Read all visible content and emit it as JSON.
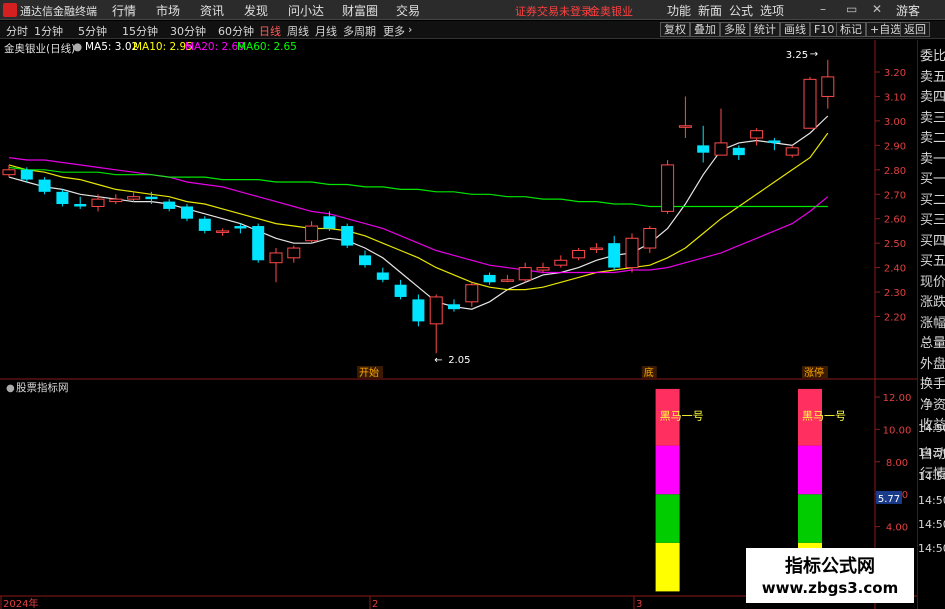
{
  "app": {
    "title": "通达信金融终端",
    "menus": [
      "行情",
      "市场",
      "资讯",
      "发现",
      "问小达",
      "财富圈",
      "交易"
    ],
    "notice": "证券交易未登录",
    "stock_name_header": "金奥银业",
    "right_menus": [
      "功能",
      "新面",
      "公式",
      "选项"
    ],
    "guest": "游客"
  },
  "toolbar": {
    "periods": [
      "分时",
      "1分钟",
      "5分钟",
      "15分钟",
      "30分钟",
      "60分钟",
      "日线",
      "周线",
      "月线",
      "多周期",
      "更多"
    ],
    "active_period": "日线",
    "buttons": [
      "复权",
      "叠加",
      "多股",
      "统计",
      "画线",
      "F10",
      "标记",
      "+自选",
      "返回"
    ]
  },
  "info": {
    "title": "金奥银业(日线)",
    "ma5": "MA5: 3.02",
    "ma10": "MA10: 2.95",
    "ma20": "MA20: 2.69",
    "ma60": "MA60: 2.65"
  },
  "colors": {
    "up": "#ff4a4a",
    "down": "#00e5ff",
    "ma5": "#ffffff",
    "ma10": "#ffff00",
    "ma20": "#ff00ff",
    "ma60": "#00ff00",
    "axis": "#8b1a1a"
  },
  "chart_data": [
    {
      "type": "candlestick",
      "title": "金奥银业(日线)",
      "ylim": [
        2.1,
        3.3
      ],
      "y_ticks": [
        "3.20",
        "3.10",
        "3.00",
        "2.90",
        "2.80",
        "2.70",
        "2.60",
        "2.50",
        "2.40",
        "2.30",
        "2.20"
      ],
      "x_labels": [
        "2024年",
        "2",
        "3"
      ],
      "annotations": [
        {
          "text": "3.25",
          "index": 46
        },
        {
          "text": "2.05",
          "index": 24
        }
      ],
      "markers": [
        {
          "text": "开始",
          "index": 20
        },
        {
          "text": "底",
          "index": 36
        },
        {
          "text": "涨停",
          "index": 45
        }
      ],
      "candles": [
        [
          2.78,
          2.8,
          2.82,
          2.77
        ],
        [
          2.8,
          2.76,
          2.81,
          2.75
        ],
        [
          2.76,
          2.71,
          2.77,
          2.7
        ],
        [
          2.71,
          2.66,
          2.72,
          2.65
        ],
        [
          2.66,
          2.65,
          2.69,
          2.64
        ],
        [
          2.65,
          2.68,
          2.7,
          2.63
        ],
        [
          2.67,
          2.68,
          2.7,
          2.66
        ],
        [
          2.68,
          2.69,
          2.71,
          2.67
        ],
        [
          2.69,
          2.68,
          2.71,
          2.66
        ],
        [
          2.67,
          2.64,
          2.68,
          2.63
        ],
        [
          2.65,
          2.6,
          2.66,
          2.59
        ],
        [
          2.6,
          2.55,
          2.61,
          2.54
        ],
        [
          2.55,
          2.55,
          2.56,
          2.53
        ],
        [
          2.57,
          2.56,
          2.58,
          2.54
        ],
        [
          2.57,
          2.43,
          2.58,
          2.42
        ],
        [
          2.42,
          2.46,
          2.48,
          2.34
        ],
        [
          2.44,
          2.48,
          2.49,
          2.42
        ],
        [
          2.51,
          2.57,
          2.59,
          2.5
        ],
        [
          2.61,
          2.56,
          2.63,
          2.55
        ],
        [
          2.57,
          2.49,
          2.58,
          2.48
        ],
        [
          2.45,
          2.41,
          2.47,
          2.4
        ],
        [
          2.38,
          2.35,
          2.4,
          2.34
        ],
        [
          2.33,
          2.28,
          2.35,
          2.27
        ],
        [
          2.27,
          2.18,
          2.29,
          2.16
        ],
        [
          2.17,
          2.28,
          2.29,
          2.05
        ],
        [
          2.25,
          2.23,
          2.27,
          2.22
        ],
        [
          2.26,
          2.33,
          2.34,
          2.24
        ],
        [
          2.37,
          2.34,
          2.38,
          2.33
        ],
        [
          2.35,
          2.35,
          2.37,
          2.34
        ],
        [
          2.35,
          2.4,
          2.42,
          2.34
        ],
        [
          2.39,
          2.4,
          2.42,
          2.38
        ],
        [
          2.41,
          2.43,
          2.45,
          2.4
        ],
        [
          2.44,
          2.47,
          2.48,
          2.43
        ],
        [
          2.48,
          2.48,
          2.5,
          2.46
        ],
        [
          2.5,
          2.4,
          2.53,
          2.39
        ],
        [
          2.4,
          2.52,
          2.54,
          2.38
        ],
        [
          2.48,
          2.56,
          2.57,
          2.46
        ],
        [
          2.63,
          2.82,
          2.84,
          2.62
        ],
        [
          2.98,
          2.98,
          3.1,
          2.93
        ],
        [
          2.9,
          2.87,
          2.98,
          2.83
        ],
        [
          2.86,
          2.91,
          3.05,
          2.86
        ],
        [
          2.89,
          2.86,
          2.9,
          2.84
        ],
        [
          2.93,
          2.96,
          2.97,
          2.9
        ],
        [
          2.92,
          2.91,
          2.93,
          2.88
        ],
        [
          2.86,
          2.89,
          2.9,
          2.85
        ],
        [
          2.97,
          3.17,
          3.18,
          2.97
        ],
        [
          3.1,
          3.18,
          3.25,
          3.05
        ]
      ],
      "ma_lines": {
        "MA5": [
          2.77,
          2.75,
          2.73,
          2.72,
          2.7,
          2.69,
          2.68,
          2.67,
          2.67,
          2.66,
          2.64,
          2.62,
          2.6,
          2.58,
          2.55,
          2.52,
          2.5,
          2.5,
          2.52,
          2.51,
          2.48,
          2.44,
          2.38,
          2.32,
          2.26,
          2.24,
          2.23,
          2.26,
          2.31,
          2.34,
          2.37,
          2.38,
          2.4,
          2.43,
          2.45,
          2.46,
          2.5,
          2.56,
          2.66,
          2.78,
          2.88,
          2.91,
          2.92,
          2.91,
          2.9,
          2.95,
          3.02
        ],
        "MA10": [
          2.82,
          2.8,
          2.79,
          2.77,
          2.76,
          2.74,
          2.72,
          2.71,
          2.7,
          2.69,
          2.67,
          2.66,
          2.64,
          2.62,
          2.6,
          2.58,
          2.57,
          2.56,
          2.56,
          2.55,
          2.53,
          2.5,
          2.47,
          2.44,
          2.4,
          2.37,
          2.34,
          2.32,
          2.31,
          2.31,
          2.32,
          2.34,
          2.36,
          2.38,
          2.39,
          2.4,
          2.41,
          2.44,
          2.48,
          2.54,
          2.6,
          2.65,
          2.7,
          2.75,
          2.8,
          2.85,
          2.95
        ],
        "MA20": [
          2.85,
          2.84,
          2.84,
          2.83,
          2.82,
          2.81,
          2.8,
          2.79,
          2.78,
          2.77,
          2.75,
          2.74,
          2.73,
          2.71,
          2.69,
          2.67,
          2.65,
          2.63,
          2.62,
          2.6,
          2.58,
          2.56,
          2.53,
          2.5,
          2.47,
          2.45,
          2.43,
          2.41,
          2.4,
          2.39,
          2.38,
          2.38,
          2.38,
          2.38,
          2.38,
          2.39,
          2.39,
          2.4,
          2.42,
          2.44,
          2.46,
          2.49,
          2.52,
          2.55,
          2.58,
          2.63,
          2.69
        ],
        "MA60": [
          2.81,
          2.8,
          2.8,
          2.79,
          2.79,
          2.79,
          2.78,
          2.78,
          2.78,
          2.77,
          2.77,
          2.77,
          2.76,
          2.76,
          2.76,
          2.75,
          2.75,
          2.75,
          2.74,
          2.74,
          2.73,
          2.73,
          2.72,
          2.72,
          2.71,
          2.71,
          2.7,
          2.7,
          2.69,
          2.69,
          2.68,
          2.68,
          2.67,
          2.67,
          2.66,
          2.66,
          2.65,
          2.65,
          2.65,
          2.65,
          2.65,
          2.65,
          2.65,
          2.65,
          2.65,
          2.65,
          2.65
        ]
      }
    },
    {
      "type": "bar",
      "title": "股票指标网",
      "ylim": [
        0,
        13
      ],
      "y_ticks": [
        "12.00",
        "10.00",
        "8.00",
        "6.00",
        "4.00"
      ],
      "highlight_value": "5.77",
      "bars": [
        {
          "index": 37,
          "label": "黑马一号",
          "segments": [
            {
              "from": 0,
              "to": 3,
              "color": "#ffff00"
            },
            {
              "from": 3,
              "to": 6,
              "color": "#00cc00"
            },
            {
              "from": 6,
              "to": 9,
              "color": "#ff00ff"
            },
            {
              "from": 9,
              "to": 12.5,
              "color": "#ff3060"
            }
          ]
        },
        {
          "index": 45,
          "label": "黑马一号",
          "segments": [
            {
              "from": 0,
              "to": 3,
              "color": "#ffff00"
            },
            {
              "from": 3,
              "to": 6,
              "color": "#00cc00"
            },
            {
              "from": 6,
              "to": 9,
              "color": "#ff00ff"
            },
            {
              "from": 9,
              "to": 12.5,
              "color": "#ff3060"
            }
          ]
        }
      ]
    }
  ],
  "sub_time_labels": [
    "14:50",
    "14:50",
    "14:50",
    "14:50",
    "14:50",
    "14:50"
  ],
  "quote_panel": [
    "委比",
    "卖五",
    "卖四",
    "卖三",
    "卖二",
    "卖一",
    "买一",
    "买二",
    "买三",
    "买四",
    "买五",
    "现价",
    "涨跌",
    "涨幅",
    "总量",
    "外盘",
    "换手",
    "净资",
    "收益",
    "自动",
    "行情"
  ],
  "watermark": {
    "line1": "指标公式网",
    "line2": "www.zbgs3.com"
  }
}
